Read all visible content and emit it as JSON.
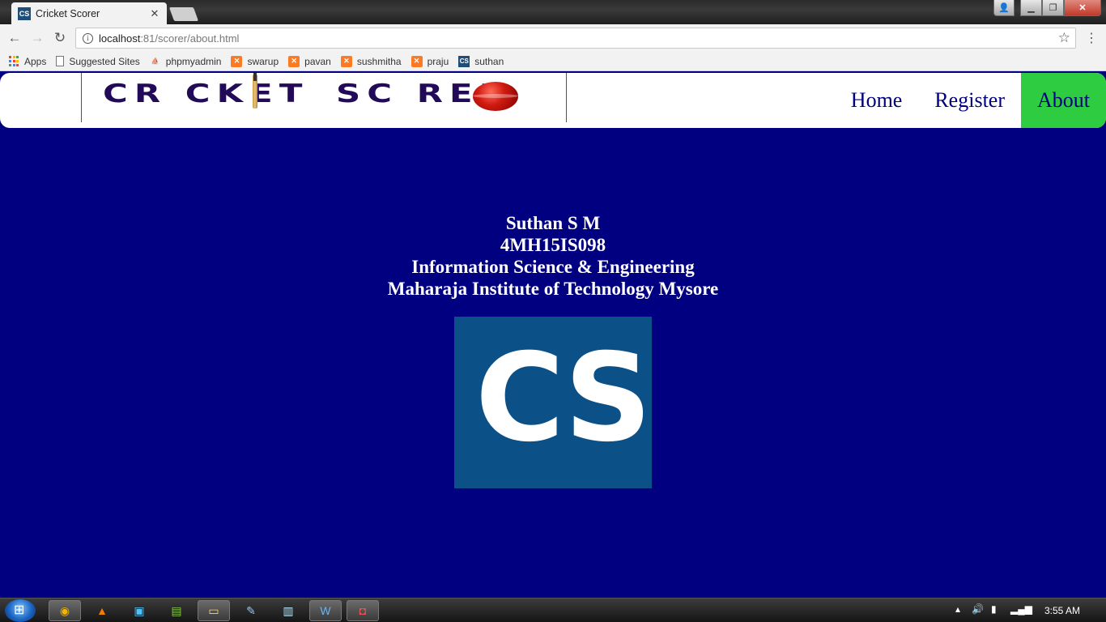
{
  "browser": {
    "tab_title": "Cricket Scorer",
    "tab_favicon": "CS",
    "url_host": "localhost",
    "url_rest": ":81/scorer/about.html",
    "bookmarks": [
      {
        "label": "Apps",
        "icon": "apps-grid-icon"
      },
      {
        "label": "Suggested Sites",
        "icon": "page-icon"
      },
      {
        "label": "phpmyadmin",
        "icon": "phpmyadmin-icon"
      },
      {
        "label": "swarup",
        "icon": "xampp-icon"
      },
      {
        "label": "pavan",
        "icon": "xampp-icon"
      },
      {
        "label": "sushmitha",
        "icon": "xampp-icon"
      },
      {
        "label": "praju",
        "icon": "xampp-icon"
      },
      {
        "label": "suthan",
        "icon": "cs-icon"
      }
    ]
  },
  "site": {
    "logo_word1": "CR CKET",
    "logo_word2": "SC RER",
    "nav": [
      {
        "label": "Home",
        "active": false
      },
      {
        "label": "Register",
        "active": false
      },
      {
        "label": "About",
        "active": true
      }
    ],
    "colors": {
      "background": "#000080",
      "nav_text": "#000080",
      "active_tab": "#2ecc40",
      "cs_logo_bg": "#0b5087"
    }
  },
  "about": {
    "name": "Suthan S M",
    "usn": "4MH15IS098",
    "department": "Information Science & Engineering",
    "college": "Maharaja Institute of Technology Mysore",
    "logo_letters": [
      "C",
      "S"
    ]
  },
  "taskbar": {
    "clock": "3:55 AM"
  }
}
